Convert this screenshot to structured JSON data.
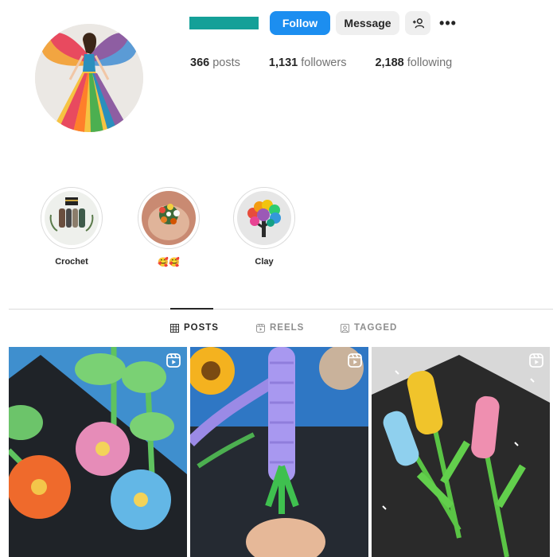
{
  "profile": {
    "buttons": {
      "follow": "Follow",
      "message": "Message",
      "add_user_icon": "add-user-icon",
      "more_icon": "more-dots-icon",
      "more_text": "•••"
    },
    "stats": {
      "posts_count": "366",
      "posts_label": "posts",
      "followers_count": "1,131",
      "followers_label": "followers",
      "following_count": "2,188",
      "following_label": "following"
    },
    "add_user_text": "+👤"
  },
  "highlights": [
    {
      "label": "Crochet"
    },
    {
      "label": "🥰🥰"
    },
    {
      "label": "Clay"
    }
  ],
  "tabs": [
    {
      "label": "POSTS",
      "icon": "grid-icon",
      "active": true
    },
    {
      "label": "REELS",
      "icon": "reels-icon",
      "active": false
    },
    {
      "label": "TAGGED",
      "icon": "tagged-icon",
      "active": false
    }
  ],
  "posts": [
    {
      "type": "reel",
      "subject": "paper flowers"
    },
    {
      "type": "reel",
      "subject": "paper lavender"
    },
    {
      "type": "reel",
      "subject": "paper hyacinths"
    }
  ],
  "colors": {
    "follow": "#1c8ef0",
    "username_bar": "#14a098",
    "secondary_btn": "#efefef"
  }
}
